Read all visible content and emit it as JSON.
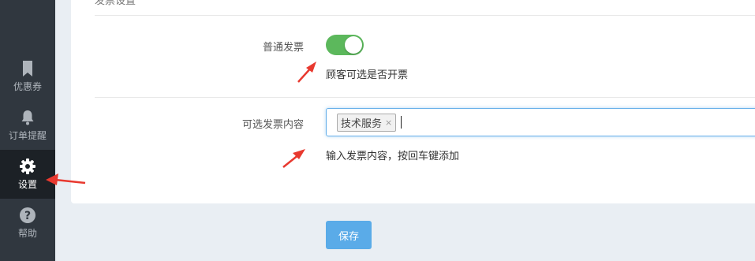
{
  "sidebar": {
    "items": [
      {
        "label": "优惠券",
        "icon": "bookmark-icon"
      },
      {
        "label": "订单提醒",
        "icon": "bell-icon"
      },
      {
        "label": "设置",
        "icon": "gear-icon",
        "active": true
      },
      {
        "label": "帮助",
        "icon": "question-icon"
      }
    ]
  },
  "section": {
    "title": "发票设置"
  },
  "invoice": {
    "toggle_label": "普通发票",
    "toggle_on": true,
    "toggle_hint": "顾客可选是否开票",
    "content_label": "可选发票内容",
    "tags": [
      "技术服务"
    ],
    "tag_remove": "×",
    "content_hint": "输入发票内容，按回车键添加"
  },
  "footer": {
    "save_label": "保存"
  },
  "colors": {
    "sidebar_bg": "#30373f",
    "sidebar_active_bg": "#1c2126",
    "toggle_on": "#5cb85c",
    "save_button": "#5aabe8",
    "annotation_arrow": "#e8392f"
  }
}
